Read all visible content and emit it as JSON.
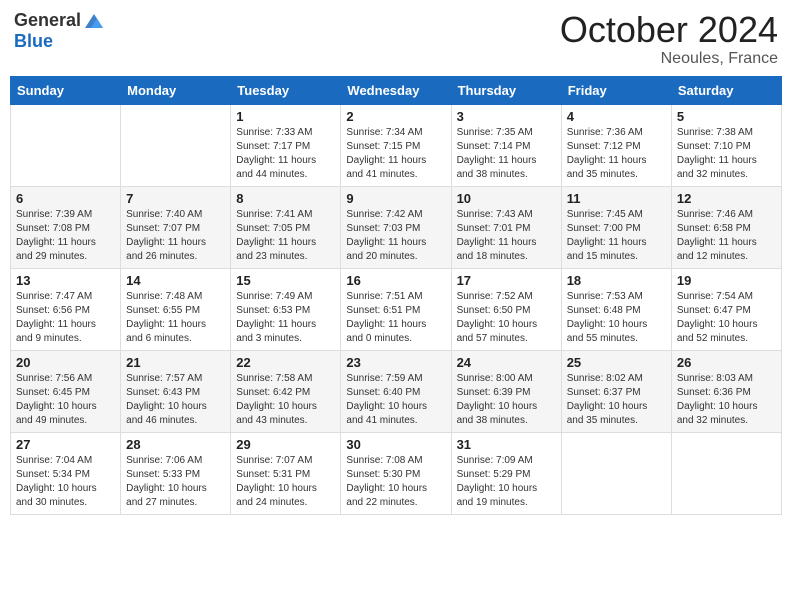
{
  "header": {
    "logo_general": "General",
    "logo_blue": "Blue",
    "month_title": "October 2024",
    "location": "Neoules, France"
  },
  "days_of_week": [
    "Sunday",
    "Monday",
    "Tuesday",
    "Wednesday",
    "Thursday",
    "Friday",
    "Saturday"
  ],
  "weeks": [
    [
      {
        "day": "",
        "sunrise": "",
        "sunset": "",
        "daylight": ""
      },
      {
        "day": "",
        "sunrise": "",
        "sunset": "",
        "daylight": ""
      },
      {
        "day": "1",
        "sunrise": "Sunrise: 7:33 AM",
        "sunset": "Sunset: 7:17 PM",
        "daylight": "Daylight: 11 hours and 44 minutes."
      },
      {
        "day": "2",
        "sunrise": "Sunrise: 7:34 AM",
        "sunset": "Sunset: 7:15 PM",
        "daylight": "Daylight: 11 hours and 41 minutes."
      },
      {
        "day": "3",
        "sunrise": "Sunrise: 7:35 AM",
        "sunset": "Sunset: 7:14 PM",
        "daylight": "Daylight: 11 hours and 38 minutes."
      },
      {
        "day": "4",
        "sunrise": "Sunrise: 7:36 AM",
        "sunset": "Sunset: 7:12 PM",
        "daylight": "Daylight: 11 hours and 35 minutes."
      },
      {
        "day": "5",
        "sunrise": "Sunrise: 7:38 AM",
        "sunset": "Sunset: 7:10 PM",
        "daylight": "Daylight: 11 hours and 32 minutes."
      }
    ],
    [
      {
        "day": "6",
        "sunrise": "Sunrise: 7:39 AM",
        "sunset": "Sunset: 7:08 PM",
        "daylight": "Daylight: 11 hours and 29 minutes."
      },
      {
        "day": "7",
        "sunrise": "Sunrise: 7:40 AM",
        "sunset": "Sunset: 7:07 PM",
        "daylight": "Daylight: 11 hours and 26 minutes."
      },
      {
        "day": "8",
        "sunrise": "Sunrise: 7:41 AM",
        "sunset": "Sunset: 7:05 PM",
        "daylight": "Daylight: 11 hours and 23 minutes."
      },
      {
        "day": "9",
        "sunrise": "Sunrise: 7:42 AM",
        "sunset": "Sunset: 7:03 PM",
        "daylight": "Daylight: 11 hours and 20 minutes."
      },
      {
        "day": "10",
        "sunrise": "Sunrise: 7:43 AM",
        "sunset": "Sunset: 7:01 PM",
        "daylight": "Daylight: 11 hours and 18 minutes."
      },
      {
        "day": "11",
        "sunrise": "Sunrise: 7:45 AM",
        "sunset": "Sunset: 7:00 PM",
        "daylight": "Daylight: 11 hours and 15 minutes."
      },
      {
        "day": "12",
        "sunrise": "Sunrise: 7:46 AM",
        "sunset": "Sunset: 6:58 PM",
        "daylight": "Daylight: 11 hours and 12 minutes."
      }
    ],
    [
      {
        "day": "13",
        "sunrise": "Sunrise: 7:47 AM",
        "sunset": "Sunset: 6:56 PM",
        "daylight": "Daylight: 11 hours and 9 minutes."
      },
      {
        "day": "14",
        "sunrise": "Sunrise: 7:48 AM",
        "sunset": "Sunset: 6:55 PM",
        "daylight": "Daylight: 11 hours and 6 minutes."
      },
      {
        "day": "15",
        "sunrise": "Sunrise: 7:49 AM",
        "sunset": "Sunset: 6:53 PM",
        "daylight": "Daylight: 11 hours and 3 minutes."
      },
      {
        "day": "16",
        "sunrise": "Sunrise: 7:51 AM",
        "sunset": "Sunset: 6:51 PM",
        "daylight": "Daylight: 11 hours and 0 minutes."
      },
      {
        "day": "17",
        "sunrise": "Sunrise: 7:52 AM",
        "sunset": "Sunset: 6:50 PM",
        "daylight": "Daylight: 10 hours and 57 minutes."
      },
      {
        "day": "18",
        "sunrise": "Sunrise: 7:53 AM",
        "sunset": "Sunset: 6:48 PM",
        "daylight": "Daylight: 10 hours and 55 minutes."
      },
      {
        "day": "19",
        "sunrise": "Sunrise: 7:54 AM",
        "sunset": "Sunset: 6:47 PM",
        "daylight": "Daylight: 10 hours and 52 minutes."
      }
    ],
    [
      {
        "day": "20",
        "sunrise": "Sunrise: 7:56 AM",
        "sunset": "Sunset: 6:45 PM",
        "daylight": "Daylight: 10 hours and 49 minutes."
      },
      {
        "day": "21",
        "sunrise": "Sunrise: 7:57 AM",
        "sunset": "Sunset: 6:43 PM",
        "daylight": "Daylight: 10 hours and 46 minutes."
      },
      {
        "day": "22",
        "sunrise": "Sunrise: 7:58 AM",
        "sunset": "Sunset: 6:42 PM",
        "daylight": "Daylight: 10 hours and 43 minutes."
      },
      {
        "day": "23",
        "sunrise": "Sunrise: 7:59 AM",
        "sunset": "Sunset: 6:40 PM",
        "daylight": "Daylight: 10 hours and 41 minutes."
      },
      {
        "day": "24",
        "sunrise": "Sunrise: 8:00 AM",
        "sunset": "Sunset: 6:39 PM",
        "daylight": "Daylight: 10 hours and 38 minutes."
      },
      {
        "day": "25",
        "sunrise": "Sunrise: 8:02 AM",
        "sunset": "Sunset: 6:37 PM",
        "daylight": "Daylight: 10 hours and 35 minutes."
      },
      {
        "day": "26",
        "sunrise": "Sunrise: 8:03 AM",
        "sunset": "Sunset: 6:36 PM",
        "daylight": "Daylight: 10 hours and 32 minutes."
      }
    ],
    [
      {
        "day": "27",
        "sunrise": "Sunrise: 7:04 AM",
        "sunset": "Sunset: 5:34 PM",
        "daylight": "Daylight: 10 hours and 30 minutes."
      },
      {
        "day": "28",
        "sunrise": "Sunrise: 7:06 AM",
        "sunset": "Sunset: 5:33 PM",
        "daylight": "Daylight: 10 hours and 27 minutes."
      },
      {
        "day": "29",
        "sunrise": "Sunrise: 7:07 AM",
        "sunset": "Sunset: 5:31 PM",
        "daylight": "Daylight: 10 hours and 24 minutes."
      },
      {
        "day": "30",
        "sunrise": "Sunrise: 7:08 AM",
        "sunset": "Sunset: 5:30 PM",
        "daylight": "Daylight: 10 hours and 22 minutes."
      },
      {
        "day": "31",
        "sunrise": "Sunrise: 7:09 AM",
        "sunset": "Sunset: 5:29 PM",
        "daylight": "Daylight: 10 hours and 19 minutes."
      },
      {
        "day": "",
        "sunrise": "",
        "sunset": "",
        "daylight": ""
      },
      {
        "day": "",
        "sunrise": "",
        "sunset": "",
        "daylight": ""
      }
    ]
  ]
}
